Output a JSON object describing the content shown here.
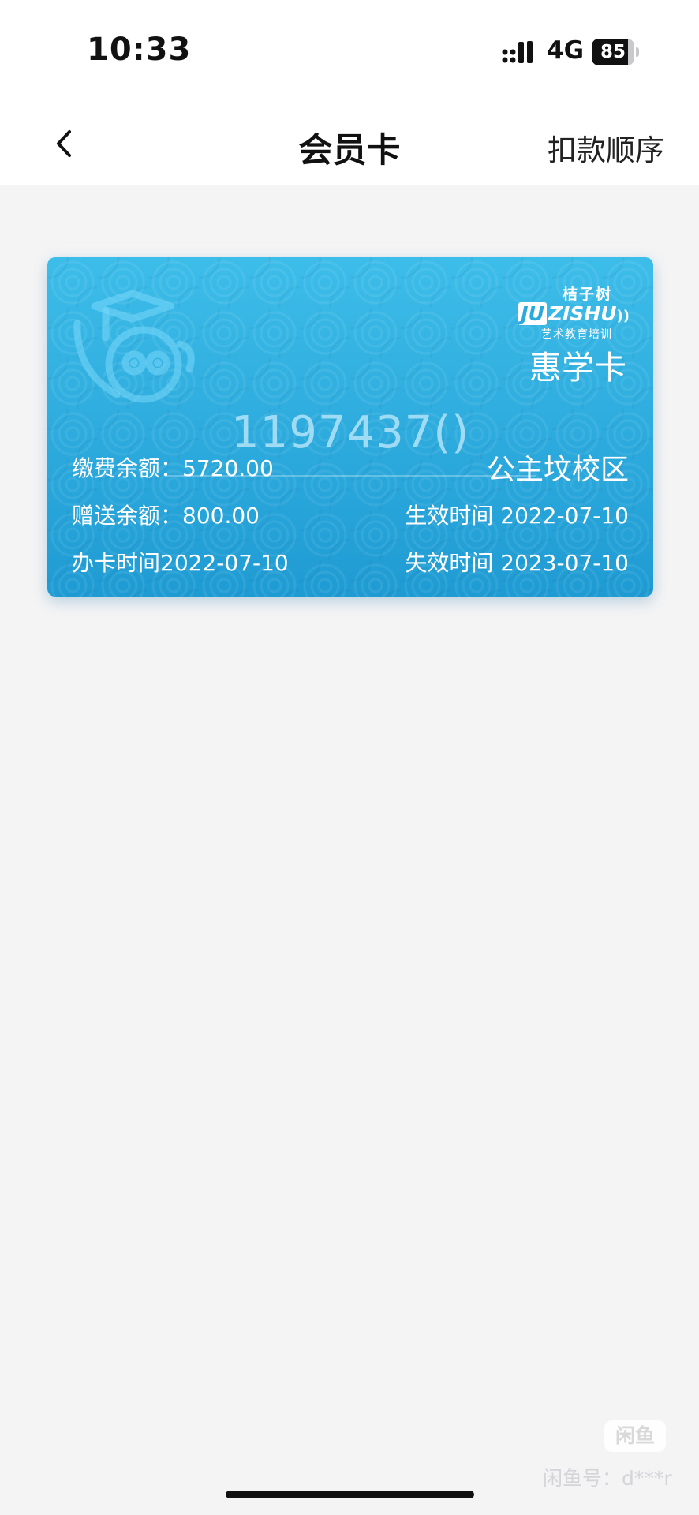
{
  "status_bar": {
    "time": "10:33",
    "network": "4G",
    "battery_level": "85",
    "battery_fraction": 0.85,
    "icons": [
      "signal-icon",
      "battery-icon"
    ]
  },
  "nav": {
    "back_icon": "chevron-left-icon",
    "title": "会员卡",
    "right_action": "扣款顺序"
  },
  "card": {
    "brand_cn": "桔子树",
    "brand_en_prefix": "JU",
    "brand_en_suffix": "ZISHU",
    "brand_tagline": "艺术教育培训",
    "card_type": "惠学卡",
    "card_number": "1197437()",
    "campus": "公主坟校区",
    "paid_balance_label": "缴费余额：",
    "paid_balance_value": "5720.00",
    "bonus_balance_label": "赠送余额：",
    "bonus_balance_value": "800.00",
    "issue_date_label": "办卡时间",
    "issue_date_value": "2022-07-10",
    "effective_label": "生效时间",
    "effective_value": "2022-07-10",
    "expire_label": "失效时间",
    "expire_value": "2023-07-10",
    "colors": {
      "card_top": "#3dbde9",
      "card_bottom": "#1f9bd3"
    },
    "watermark_icon": "graduate-mascot-icon"
  },
  "watermark": {
    "badge": "闲鱼",
    "id_text": "闲鱼号：d***r"
  }
}
